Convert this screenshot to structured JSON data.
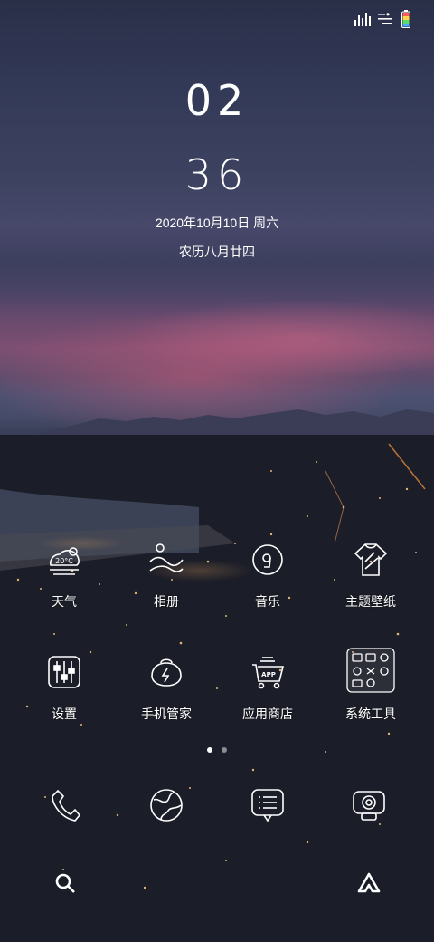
{
  "status_bar": {
    "icons": [
      "signal-icon",
      "wifi-icon",
      "battery-icon"
    ],
    "battery_colors": [
      "#ff5b5b",
      "#ffd34d",
      "#5ddc6b",
      "#4fa8ff"
    ]
  },
  "lockscreen": {
    "hour": "02",
    "minute": "36",
    "date": "2020年10月10日 周六",
    "lunar_date": "农历八月廿四"
  },
  "home_apps": [
    {
      "label": "天气",
      "icon": "weather-icon",
      "icon_text": "20°C"
    },
    {
      "label": "相册",
      "icon": "gallery-icon"
    },
    {
      "label": "音乐",
      "icon": "music-icon"
    },
    {
      "label": "主题壁纸",
      "icon": "theme-icon"
    },
    {
      "label": "设置",
      "icon": "settings-icon"
    },
    {
      "label": "手机管家",
      "icon": "phone-manager-icon"
    },
    {
      "label": "应用商店",
      "icon": "app-store-icon",
      "icon_text": "APP"
    },
    {
      "label": "系统工具",
      "icon": "system-tools-folder-icon"
    }
  ],
  "page_indicator": {
    "pages": 2,
    "current": 1
  },
  "dock": [
    {
      "icon": "phone-icon"
    },
    {
      "icon": "browser-icon"
    },
    {
      "icon": "messages-icon"
    },
    {
      "icon": "camera-icon"
    }
  ],
  "bottom_bar": {
    "left_icon": "search-icon",
    "right_icon": "assistant-icon"
  }
}
